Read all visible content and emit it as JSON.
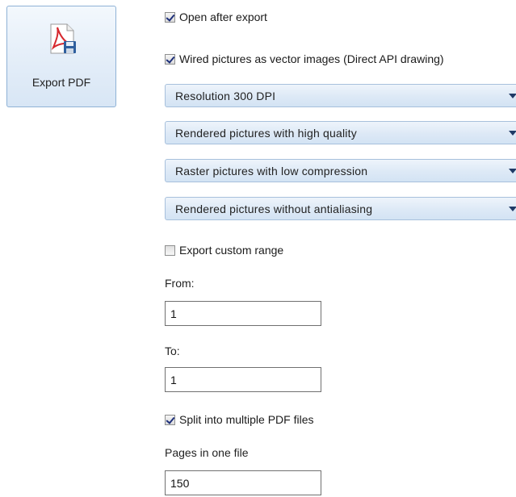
{
  "export_button": {
    "label": "Export PDF",
    "icon": "pdf-save-icon"
  },
  "options": {
    "open_after_export": {
      "label": "Open after export",
      "checked": true
    },
    "wired_pictures": {
      "label": "Wired pictures as vector images (Direct API drawing)",
      "checked": true
    },
    "combos": [
      {
        "value": "Resolution 300 DPI"
      },
      {
        "value": "Rendered pictures with high quality"
      },
      {
        "value": "Raster pictures with low compression"
      },
      {
        "value": "Rendered pictures without antialiasing"
      }
    ],
    "export_custom_range": {
      "label": "Export custom range",
      "checked": false
    },
    "from": {
      "label": "From:",
      "value": "1"
    },
    "to": {
      "label": "To:",
      "value": "1"
    },
    "split_files": {
      "label": "Split into multiple PDF files",
      "checked": true
    },
    "pages_in_one_file": {
      "label": "Pages in one file",
      "value": "150"
    }
  },
  "colors": {
    "button_border": "#8fb2d6",
    "combo_border": "#a7c0dc",
    "pdf_red": "#d6282e",
    "disk_blue": "#2f5f9e"
  }
}
